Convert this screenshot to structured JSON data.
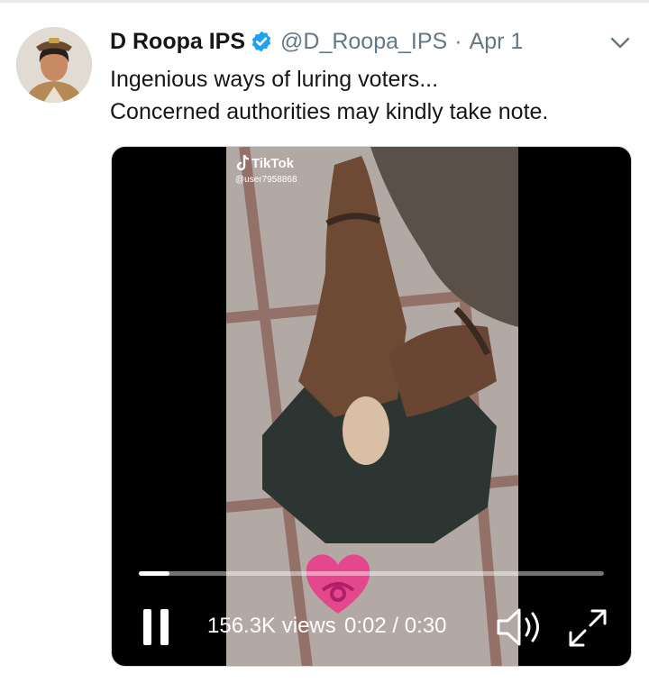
{
  "tweet": {
    "display_name": "D Roopa IPS",
    "handle": "@D_Roopa_IPS",
    "separator": "·",
    "date": "Apr 1",
    "text_lines": [
      "Ingenious ways of luring voters...",
      "Concerned authorities may kindly take note."
    ]
  },
  "video": {
    "watermark_brand": "TikTok",
    "watermark_user": "@user7958868",
    "views": "156.3K views",
    "elapsed_total": "0:02 / 0:30",
    "progress_fraction": 0.066
  },
  "colors": {
    "verified_badge": "#1da1f2",
    "secondary_text": "#657786",
    "primary_text": "#14171a",
    "heart_pink": "#e83f8a"
  },
  "icons": {
    "verified": "verified-badge-icon",
    "menu": "chevron-down-icon",
    "pause": "pause-icon",
    "volume": "volume-icon",
    "fullscreen": "fullscreen-icon",
    "tiktok": "tiktok-note-icon"
  }
}
